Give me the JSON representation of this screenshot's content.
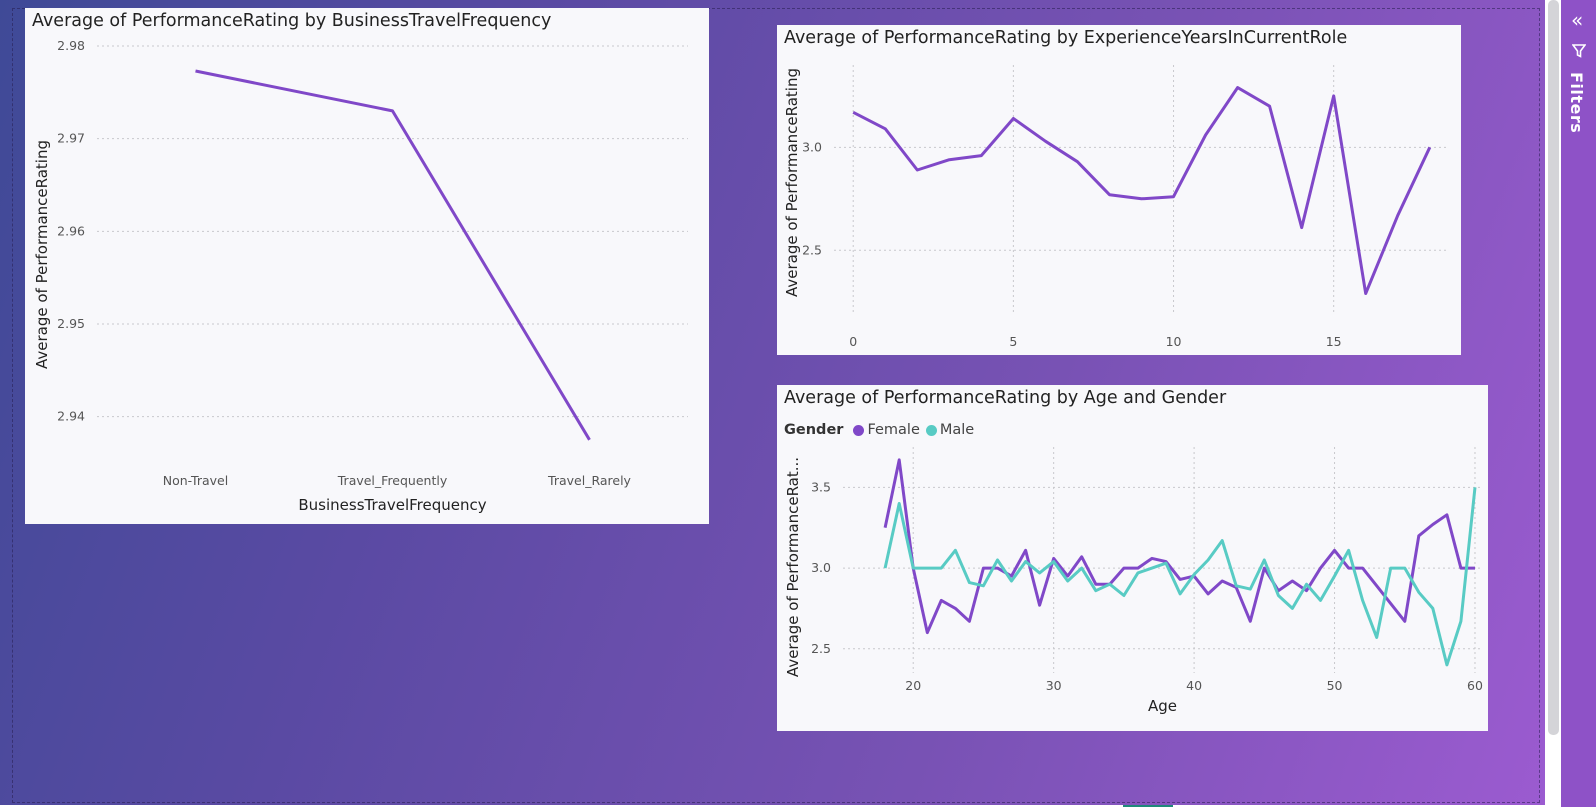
{
  "colors": {
    "line": "#8048c8",
    "female": "#8048c8",
    "male": "#58cbc4",
    "tick": "#555555"
  },
  "filters_pane": {
    "label": "Filters",
    "collapse_icon": "double-chevron-left-icon",
    "filter_icon": "funnel-icon"
  },
  "chart_data": [
    {
      "type": "line",
      "title": "Average of PerformanceRating by BusinessTravelFrequency",
      "xlabel": "BusinessTravelFrequency",
      "ylabel": "Average of PerformanceRating",
      "categories": [
        "Non-Travel",
        "Travel_Frequently",
        "Travel_Rarely"
      ],
      "values": [
        2.9773,
        2.973,
        2.9375
      ],
      "ylim": [
        2.935,
        2.98
      ],
      "yticks": [
        "2.98",
        "2.97",
        "2.96",
        "2.95",
        "2.94"
      ],
      "grid": true
    },
    {
      "type": "line",
      "title": "Average of PerformanceRating by ExperienceYearsInCurrentRole",
      "xlabel": "ExperienceYearsInCurrentRole",
      "ylabel": "Average of PerformanceRating",
      "x": [
        0,
        1,
        2,
        3,
        4,
        5,
        6,
        7,
        8,
        9,
        10,
        11,
        12,
        13,
        14,
        15,
        16,
        17,
        18
      ],
      "values": [
        3.17,
        3.09,
        2.89,
        2.94,
        2.96,
        3.14,
        3.03,
        2.93,
        2.77,
        2.75,
        2.76,
        3.06,
        3.29,
        3.2,
        2.61,
        3.25,
        2.29,
        2.67,
        3.0
      ],
      "xlim": [
        -0.6,
        18.6
      ],
      "ylim": [
        2.2,
        3.4
      ],
      "xticks": [
        "0",
        "5",
        "10",
        "15"
      ],
      "yticks": [
        "3.0",
        "2.5"
      ],
      "grid": true
    },
    {
      "type": "line",
      "title": "Average of PerformanceRating by Age and Gender",
      "xlabel": "Age",
      "ylabel": "Average of PerformanceRat...",
      "legend_title": "Gender",
      "legend_placement": "top-left",
      "x": [
        18,
        19,
        20,
        21,
        22,
        23,
        24,
        25,
        26,
        27,
        28,
        29,
        30,
        31,
        32,
        33,
        34,
        35,
        36,
        37,
        38,
        39,
        40,
        41,
        42,
        43,
        44,
        45,
        46,
        47,
        48,
        49,
        50,
        51,
        52,
        53,
        54,
        55,
        56,
        57,
        58,
        59,
        60
      ],
      "series": [
        {
          "name": "Female",
          "values": [
            3.25,
            3.67,
            3.0,
            2.6,
            2.8,
            2.75,
            2.67,
            3.0,
            3.0,
            2.95,
            3.11,
            2.77,
            3.06,
            2.95,
            3.07,
            2.9,
            2.9,
            3.0,
            3.0,
            3.06,
            3.04,
            2.93,
            2.95,
            2.84,
            2.92,
            2.88,
            2.67,
            3.0,
            2.86,
            2.92,
            2.86,
            3.0,
            3.11,
            3.0,
            3.0,
            2.89,
            2.78,
            2.67,
            3.2,
            3.27,
            3.33,
            3.0,
            3.0
          ]
        },
        {
          "name": "Male",
          "values": [
            3.0,
            3.4,
            3.0,
            3.0,
            3.0,
            3.11,
            2.91,
            2.89,
            3.05,
            2.92,
            3.04,
            2.97,
            3.04,
            2.92,
            3.0,
            2.86,
            2.9,
            2.83,
            2.97,
            3.0,
            3.03,
            2.84,
            2.96,
            3.05,
            3.17,
            2.89,
            2.87,
            3.05,
            2.83,
            2.75,
            2.9,
            2.8,
            2.95,
            3.11,
            2.8,
            2.57,
            3.0,
            3.0,
            2.85,
            2.75,
            2.4,
            2.67,
            3.5
          ]
        }
      ],
      "xlim": [
        15,
        60.5
      ],
      "ylim": [
        2.35,
        3.75
      ],
      "xticks": [
        "20",
        "30",
        "40",
        "50",
        "60"
      ],
      "yticks": [
        "3.5",
        "3.0",
        "2.5"
      ],
      "grid": true
    }
  ]
}
